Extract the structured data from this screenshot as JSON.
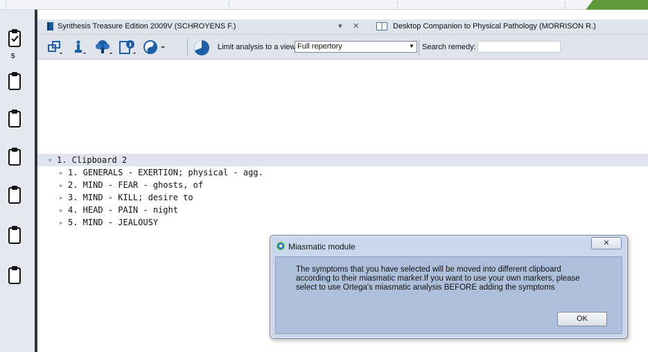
{
  "tabs": [
    {
      "label": "Synthesis Treasure Edition 2009V (SCHROYENS F.)",
      "icon": "book-icon"
    },
    {
      "label": "Desktop Companion to Physical Pathology (MORRISON R.)",
      "icon": "open-book-icon"
    }
  ],
  "tab_controls": {
    "dropdown": "▾",
    "close": "✕"
  },
  "toolbar": {
    "limit_label": "Limit analysis to a view",
    "view_value": "Full repertory",
    "search_label": "Search remedy:",
    "search_value": ""
  },
  "clipboard_sidebar": {
    "active_count": "5",
    "clipboards": [
      "clipboard-1",
      "clipboard-2",
      "clipboard-3",
      "clipboard-4",
      "clipboard-5",
      "clipboard-6",
      "clipboard-7"
    ]
  },
  "tree": {
    "root": "1. Clipboard 2",
    "items": [
      "1. GENERALS - EXERTION; physical - agg.",
      "2. MIND - FEAR - ghosts, of",
      "3. MIND - KILL; desire to",
      "4. HEAD - PAIN - night",
      "5. MIND - JEALOUSY"
    ]
  },
  "dialog": {
    "title": "Miasmatic module",
    "close_label": "✕",
    "message_lines": [
      "The symptoms that you have selected will be moved into different clipboard",
      "according to their miasmatic marker.If you want to use your own markers, please",
      "select to use Ortega's miasmatic analysis BEFORE adding the symptoms"
    ],
    "ok_label": "OK"
  },
  "colors": {
    "accent": "#1e5b96",
    "dialog_bg": "#aebfdb",
    "green_corner": "#5f9a3a"
  }
}
